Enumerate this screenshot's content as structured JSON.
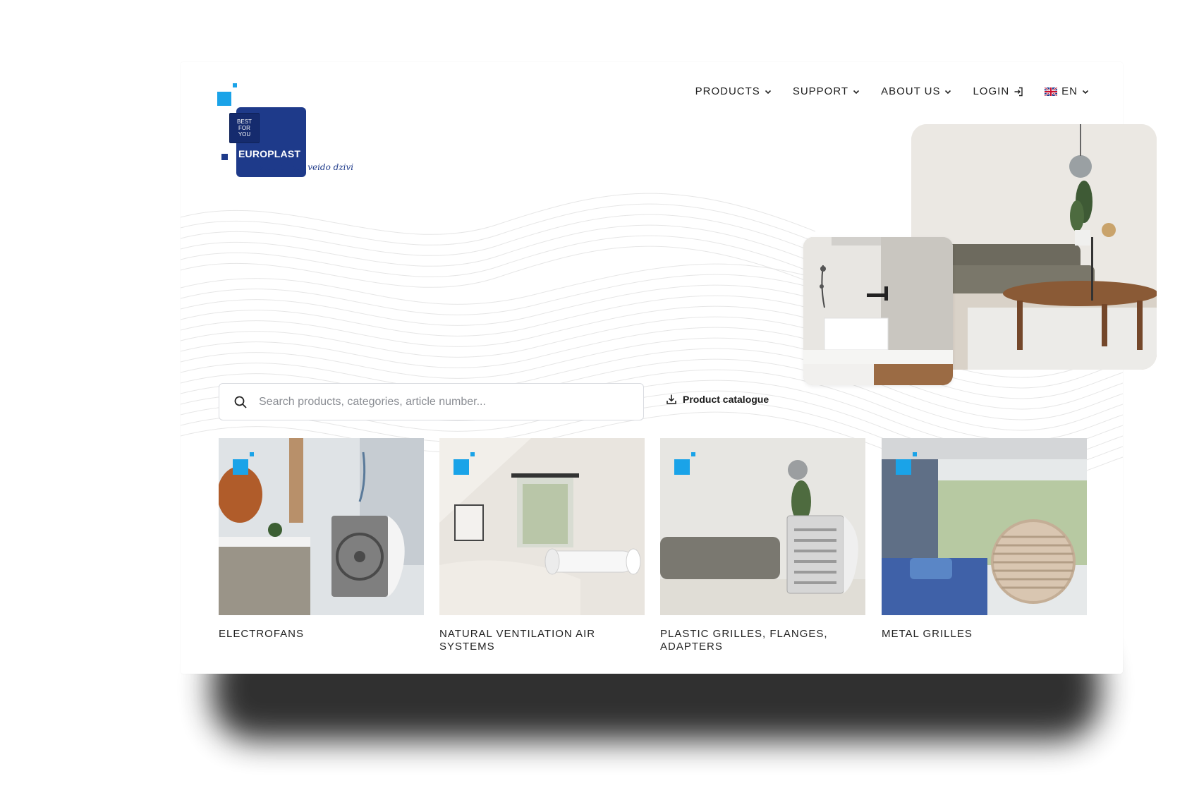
{
  "logo": {
    "badge_lines": [
      "BEST",
      "FOR",
      "YOU"
    ],
    "brand": "EUROPLAST",
    "tagline": "elpo brivi - veido dzivi"
  },
  "nav": {
    "items": [
      {
        "label": "PRODUCTS",
        "icon": "chevron-down-icon"
      },
      {
        "label": "SUPPORT",
        "icon": "chevron-down-icon"
      },
      {
        "label": "ABOUT US",
        "icon": "chevron-down-icon"
      },
      {
        "label": "LOGIN",
        "icon": "login-icon"
      }
    ],
    "language": {
      "code": "EN",
      "icon": "uk-flag-icon"
    }
  },
  "search": {
    "placeholder": "Search products, categories, article number...",
    "icon": "search-icon"
  },
  "catalogue": {
    "label": "Product catalogue",
    "icon": "download-icon"
  },
  "categories": [
    {
      "label": "ELECTROFANS"
    },
    {
      "label": "NATURAL VENTILATION AIR SYSTEMS"
    },
    {
      "label": "PLASTIC GRILLES, FLANGES, ADAPTERS"
    },
    {
      "label": "METAL GRILLES"
    }
  ],
  "colors": {
    "accent": "#1aa3e8",
    "brand": "#1e3a8a"
  }
}
